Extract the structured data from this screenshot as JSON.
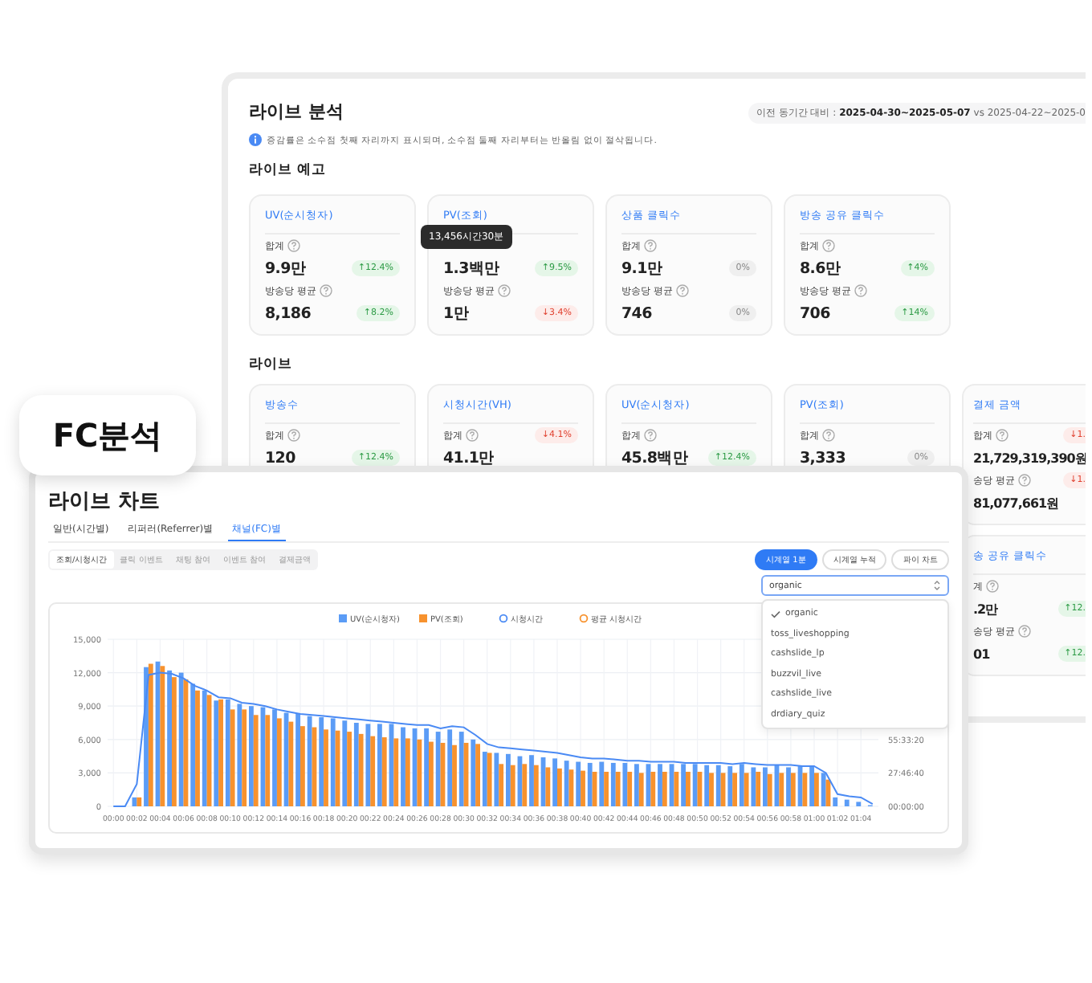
{
  "analysis": {
    "title": "라이브 분석",
    "comparison": "이전 동기간 대비 : **2025-04-30~2025-05-07** vs 2025-04-22~2025-0",
    "note": "증감률은 소수점 첫째 자리까지 표시되며, 소수점 둘째 자리부터는 반올림 없이 절삭됩니다.",
    "preview": {
      "heading": "라이브 예고",
      "cards": [
        {
          "title": "UV(순시청자)",
          "lines": [
            {
              "kind": "label",
              "text": "합계"
            },
            {
              "kind": "value",
              "text": "9.9만",
              "badge": {
                "text": "↑12.4%",
                "kind": "up"
              }
            },
            {
              "kind": "label",
              "text": "방송당 평균"
            },
            {
              "kind": "value",
              "text": "8,186",
              "badge": {
                "text": "↑8.2%",
                "kind": "up"
              }
            }
          ]
        },
        {
          "title": "PV(조회)",
          "tooltip": "13,456시간30분",
          "lines": [
            {
              "kind": "label"
            },
            {
              "kind": "value",
              "text": "1.3백만",
              "badge": {
                "text": "↑9.5%",
                "kind": "up"
              }
            },
            {
              "kind": "label",
              "text": "방송당 평균"
            },
            {
              "kind": "value",
              "text": "1만",
              "badge": {
                "text": "↓3.4%",
                "kind": "down"
              }
            }
          ]
        },
        {
          "title": "상품 클릭수",
          "lines": [
            {
              "kind": "label",
              "text": "합계"
            },
            {
              "kind": "value",
              "text": "9.1만",
              "badge": {
                "text": "0%",
                "kind": "flat"
              }
            },
            {
              "kind": "label",
              "text": "방송당 평균"
            },
            {
              "kind": "value",
              "text": "746",
              "badge": {
                "text": "0%",
                "kind": "flat"
              }
            }
          ]
        },
        {
          "title": "방송 공유 클릭수",
          "lines": [
            {
              "kind": "label",
              "text": "합계"
            },
            {
              "kind": "value",
              "text": "8.6만",
              "badge": {
                "text": "↑4%",
                "kind": "up"
              }
            },
            {
              "kind": "label",
              "text": "방송당 평균"
            },
            {
              "kind": "value",
              "text": "706",
              "badge": {
                "text": "↑14%",
                "kind": "up"
              }
            }
          ]
        }
      ]
    },
    "live": {
      "heading": "라이브",
      "cards": [
        {
          "title": "방송수",
          "lines": [
            {
              "kind": "label",
              "text": "합계"
            },
            {
              "kind": "value",
              "text": "120",
              "badge": {
                "text": "↑12.4%",
                "kind": "up"
              }
            }
          ]
        },
        {
          "title": "시청시간(VH)",
          "lines": [
            {
              "kind": "label",
              "text": "합계",
              "badge": {
                "text": "↓4.1%",
                "kind": "down"
              }
            },
            {
              "kind": "value",
              "text": "41.1만"
            }
          ]
        },
        {
          "title": "UV(순시청자)",
          "lines": [
            {
              "kind": "label",
              "text": "합계"
            },
            {
              "kind": "value",
              "text": "45.8백만",
              "badge": {
                "text": "↑12.4%",
                "kind": "up"
              }
            }
          ]
        },
        {
          "title": "PV(조회)",
          "lines": [
            {
              "kind": "label",
              "text": "합계"
            },
            {
              "kind": "value",
              "text": "3,333",
              "badge": {
                "text": "0%",
                "kind": "flat"
              }
            }
          ]
        },
        {
          "title": "결제 금액",
          "lines": [
            {
              "kind": "label",
              "text": "합계",
              "badge": {
                "text": "↓1.",
                "kind": "down"
              }
            },
            {
              "kind": "value",
              "text": "21,729,319,390원"
            },
            {
              "kind": "label",
              "text": "송당 평균",
              "badge": {
                "text": "↓1.",
                "kind": "down"
              }
            },
            {
              "kind": "value",
              "text": "81,077,661원"
            }
          ]
        },
        {
          "title": "송 공유 클릭수",
          "lines": [
            {
              "kind": "label",
              "text": "계"
            },
            {
              "kind": "value",
              "text": ".2만",
              "badge": {
                "text": "↑12.",
                "kind": "up"
              }
            },
            {
              "kind": "label",
              "text": "송당 평균"
            },
            {
              "kind": "value",
              "text": "01",
              "badge": {
                "text": "↑12.",
                "kind": "up"
              }
            }
          ]
        }
      ]
    }
  },
  "feature_label": "FC분석",
  "chart_panel": {
    "title": "라이브 차트",
    "tabs": [
      {
        "label": "일반(시간별)",
        "selected": false
      },
      {
        "label": "리퍼러(Referrer)별",
        "selected": false
      },
      {
        "label": "채널(FC)별",
        "selected": true
      }
    ],
    "metrics": [
      {
        "label": "조회/시청시간",
        "selected": true
      },
      {
        "label": "클릭 이벤트",
        "selected": false
      },
      {
        "label": "채팅 참여",
        "selected": false
      },
      {
        "label": "이벤트 참여",
        "selected": false
      },
      {
        "label": "결제금액",
        "selected": false
      }
    ],
    "views": [
      {
        "label": "시계열 1분",
        "selected": true
      },
      {
        "label": "시계열 누적",
        "selected": false
      },
      {
        "label": "파이 차트",
        "selected": false
      }
    ],
    "channel_select": {
      "value": "organic",
      "options": [
        {
          "label": "organic",
          "selected": true
        },
        {
          "label": "toss_liveshopping",
          "selected": false
        },
        {
          "label": "cashslide_lp",
          "selected": false
        },
        {
          "label": "buzzvil_live",
          "selected": false
        },
        {
          "label": "cashslide_live",
          "selected": false
        },
        {
          "label": "drdiary_quiz",
          "selected": false
        }
      ]
    },
    "chart_data": {
      "type": "bar",
      "ylim": [
        0,
        15000
      ],
      "stacked": false,
      "grid": true,
      "legend": "top",
      "yticks": [
        {
          "value": 0,
          "label": "0"
        },
        {
          "value": 3000,
          "label": "3,000"
        },
        {
          "value": 6000,
          "label": "6,000"
        },
        {
          "value": 9000,
          "label": "9,000"
        },
        {
          "value": 12000,
          "label": "12,000"
        },
        {
          "value": 15000,
          "label": "15,000"
        }
      ],
      "categories": [
        "00:00",
        null,
        "00:02",
        null,
        "00:04",
        null,
        "00:06",
        null,
        "00:08",
        null,
        "00:10",
        null,
        "00:12",
        null,
        "00:14",
        null,
        "00:16",
        null,
        "00:18",
        null,
        "00:20",
        null,
        "00:22",
        null,
        "00:24",
        null,
        "00:26",
        null,
        "00:28",
        null,
        "00:30",
        null,
        "00:32",
        null,
        "00:34",
        null,
        "00:36",
        null,
        "00:38",
        null,
        "00:40",
        null,
        "00:42",
        null,
        "00:44",
        null,
        "00:46",
        null,
        "00:48",
        null,
        "00:50",
        null,
        "00:52",
        null,
        "00:54",
        null,
        "00:56",
        null,
        "00:58",
        null,
        "01:00",
        null,
        "01:02",
        null,
        "01:04",
        null
      ],
      "series": [
        {
          "name": "UV(순시청자)",
          "color": "#5b9cf6",
          "type": "bar",
          "values": [
            0,
            0,
            800,
            12500,
            13000,
            12200,
            12000,
            11000,
            10400,
            9500,
            9600,
            9200,
            9000,
            8900,
            8700,
            8400,
            8300,
            8100,
            8000,
            7900,
            7700,
            7500,
            7400,
            7400,
            7400,
            7100,
            7000,
            7000,
            6700,
            6900,
            6700,
            6000,
            4900,
            4800,
            4700,
            4500,
            4600,
            4400,
            4300,
            4100,
            4000,
            3900,
            4000,
            3900,
            3900,
            3800,
            3800,
            3800,
            3800,
            3800,
            3800,
            3700,
            3700,
            3600,
            3800,
            3500,
            3500,
            3700,
            3500,
            3600,
            3600,
            3000,
            800,
            600,
            400,
            100
          ]
        },
        {
          "name": "PV(조회)",
          "color": "#f7922e",
          "type": "bar",
          "values": [
            0,
            0,
            800,
            12800,
            12600,
            11600,
            11400,
            10400,
            10000,
            9600,
            8700,
            8700,
            8200,
            8200,
            7900,
            7600,
            7200,
            7100,
            6900,
            6800,
            6700,
            6500,
            6300,
            6200,
            6100,
            6100,
            6000,
            5800,
            5700,
            5500,
            5700,
            5600,
            4800,
            3800,
            3700,
            3800,
            3700,
            3500,
            3400,
            3300,
            3200,
            3100,
            3100,
            3100,
            3100,
            3000,
            3100,
            3100,
            3100,
            3100,
            3100,
            3000,
            3000,
            3000,
            3000,
            3100,
            2900,
            3000,
            3000,
            3000,
            3000,
            2400,
            0,
            0,
            0,
            0
          ]
        },
        {
          "name": "시청시간",
          "color": "#4a8af4",
          "type": "line",
          "values": [
            0,
            0,
            2000,
            11800,
            12000,
            11900,
            11500,
            10800,
            10400,
            9800,
            9700,
            9300,
            9200,
            9000,
            8700,
            8500,
            8300,
            8200,
            8100,
            8000,
            7900,
            7800,
            7700,
            7600,
            7500,
            7400,
            7300,
            7300,
            7000,
            7200,
            7100,
            6400,
            5600,
            5300,
            5200,
            5100,
            5000,
            4900,
            4800,
            4600,
            4400,
            4300,
            4300,
            4200,
            4100,
            4100,
            4000,
            4000,
            4000,
            3900,
            3900,
            3900,
            3900,
            3800,
            3900,
            3800,
            3700,
            3700,
            3700,
            3600,
            3600,
            3000,
            1100,
            900,
            800,
            200
          ]
        },
        {
          "name": "평균 시청시간",
          "color": "#f7922e",
          "type": "line",
          "values": [
            null,
            null,
            null,
            null,
            null,
            null,
            null,
            null,
            null,
            null,
            null,
            null,
            null,
            null,
            null,
            null,
            null,
            null,
            null,
            null,
            null,
            null,
            null,
            null,
            null,
            null,
            null,
            null,
            null,
            null,
            null,
            null,
            null,
            null,
            null,
            null,
            null,
            null,
            null,
            null,
            null,
            null,
            null,
            null,
            null,
            null,
            null,
            null,
            null,
            null,
            null,
            null,
            null,
            null,
            null,
            null,
            null,
            null,
            null,
            null,
            null,
            null,
            null,
            null,
            null,
            null
          ]
        }
      ]
    },
    "secondary_axis_labels": [
      "55:33:20",
      "27:46:40",
      "00:00:00"
    ]
  }
}
